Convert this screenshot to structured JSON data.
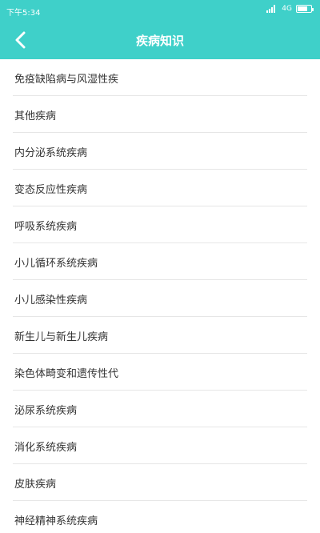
{
  "status_bar": {
    "time": "下午5:34",
    "network": "4G"
  },
  "header": {
    "title": "疾病知识",
    "background_color": "#3fd0c9",
    "back_icon": "chevron-left-icon"
  },
  "categories": [
    {
      "label": "免疫缺陷病与风湿性疾"
    },
    {
      "label": "其他疾病"
    },
    {
      "label": "内分泌系统疾病"
    },
    {
      "label": "变态反应性疾病"
    },
    {
      "label": "呼吸系统疾病"
    },
    {
      "label": "小儿循环系统疾病"
    },
    {
      "label": "小儿感染性疾病"
    },
    {
      "label": "新生儿与新生儿疾病"
    },
    {
      "label": "染色体畸变和遗传性代"
    },
    {
      "label": "泌尿系统疾病"
    },
    {
      "label": "消化系统疾病"
    },
    {
      "label": "皮肤疾病"
    },
    {
      "label": "神经精神系统疾病"
    }
  ]
}
